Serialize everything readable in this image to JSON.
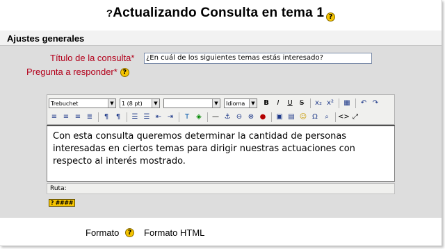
{
  "page": {
    "title": "Actualizando Consulta en tema 1",
    "title_prefix": "?",
    "section": "Ajustes generales"
  },
  "form": {
    "question_title_label": "Título de la consulta",
    "question_title_value": "¿En cuál de los siguientes temas estás interesado?",
    "question_label": "Pregunta a responder",
    "required_mark": "*",
    "help_glyph": "?"
  },
  "editor": {
    "font_family": "Trebuchet",
    "font_size": "1 (8 pt)",
    "format": "",
    "language": "Idioma",
    "content": "Con esta consulta queremos determinar la cantidad de personas interesadas en ciertos temas para dirigir nuestras actuaciones con respecto al interés mostrado.",
    "path_label": "Ruta:",
    "hint_button": "? ####"
  },
  "format_row": {
    "label": "Formato",
    "value": "Formato HTML"
  },
  "colors": {
    "required_red": "#b3001b",
    "help_yellow": "#f5c400",
    "panel_gray": "#dddddd"
  }
}
